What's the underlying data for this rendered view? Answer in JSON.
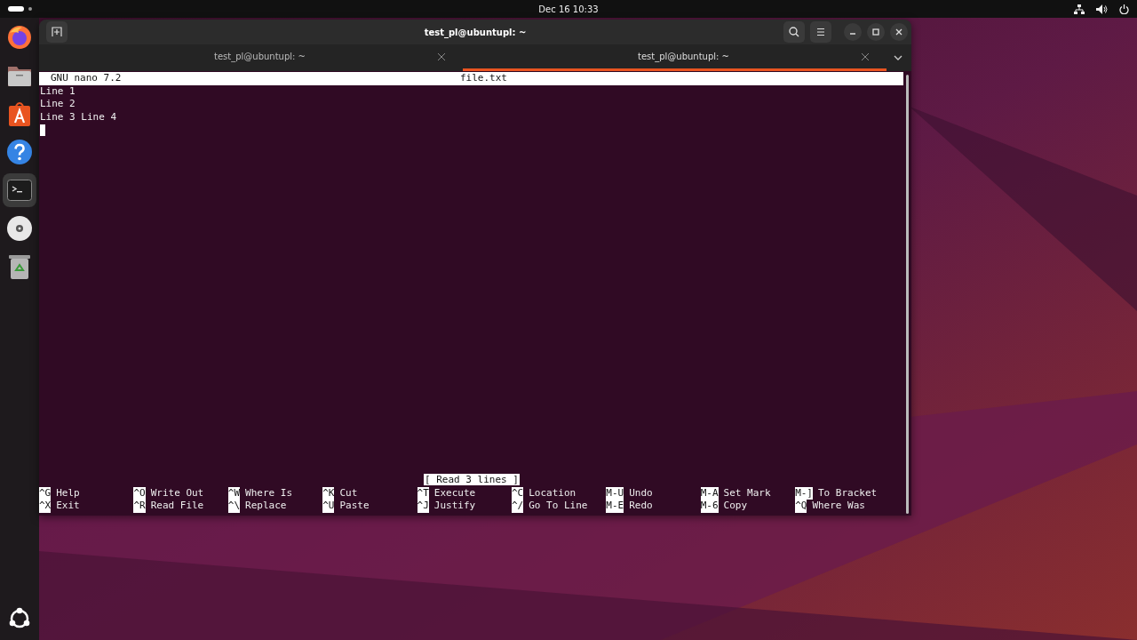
{
  "top_bar": {
    "clock": "Dec 16  10:33"
  },
  "dock": {
    "items": [
      {
        "kind": "firefox",
        "selected": false
      },
      {
        "kind": "files",
        "selected": false
      },
      {
        "kind": "appstore",
        "selected": false
      },
      {
        "kind": "help",
        "selected": false
      },
      {
        "kind": "terminal",
        "selected": true
      },
      {
        "kind": "disc",
        "selected": false
      },
      {
        "kind": "trash",
        "selected": false
      }
    ]
  },
  "window": {
    "title": "test_pl@ubuntupl: ~",
    "tabs": [
      {
        "label": "test_pl@ubuntupl: ~",
        "selected": false
      },
      {
        "label": "test_pl@ubuntupl: ~",
        "selected": true
      }
    ],
    "editor": {
      "app": "GNU nano 7.2",
      "filename": "file.txt",
      "lines": [
        "Line 1",
        "Line 2",
        "Line 3 Line 4"
      ],
      "status": "[ Read 3 lines ]",
      "shortcuts": [
        [
          {
            "key": "^G",
            "label": "Help"
          },
          {
            "key": "^X",
            "label": "Exit"
          }
        ],
        [
          {
            "key": "^O",
            "label": "Write Out"
          },
          {
            "key": "^R",
            "label": "Read File"
          }
        ],
        [
          {
            "key": "^W",
            "label": "Where Is"
          },
          {
            "key": "^\\",
            "label": "Replace"
          }
        ],
        [
          {
            "key": "^K",
            "label": "Cut"
          },
          {
            "key": "^U",
            "label": "Paste"
          }
        ],
        [
          {
            "key": "^T",
            "label": "Execute"
          },
          {
            "key": "^J",
            "label": "Justify"
          }
        ],
        [
          {
            "key": "^C",
            "label": "Location"
          },
          {
            "key": "^/",
            "label": "Go To Line"
          }
        ],
        [
          {
            "key": "M-U",
            "label": "Undo"
          },
          {
            "key": "M-E",
            "label": "Redo"
          }
        ],
        [
          {
            "key": "M-A",
            "label": "Set Mark"
          },
          {
            "key": "M-6",
            "label": "Copy"
          }
        ],
        [
          {
            "key": "M-]",
            "label": "To Bracket"
          },
          {
            "key": "^Q",
            "label": "Where Was"
          }
        ]
      ]
    }
  }
}
